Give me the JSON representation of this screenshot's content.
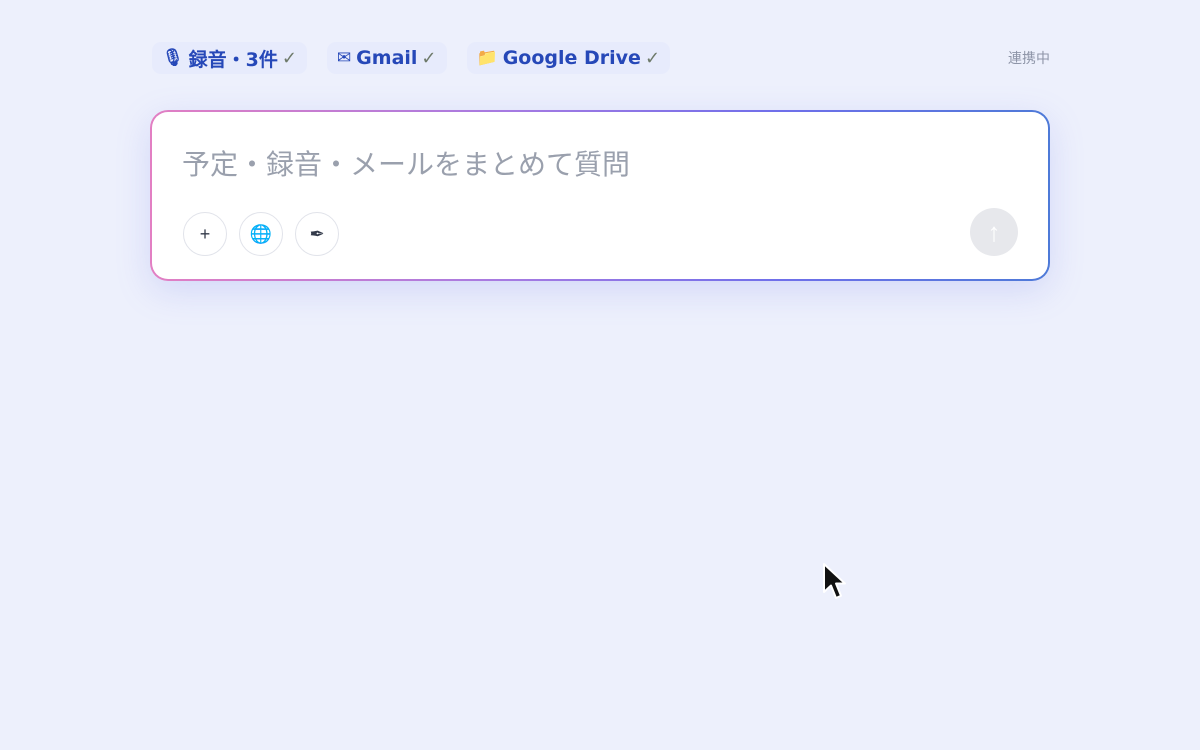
{
  "sources": [
    {
      "icon": "🎙",
      "label": "録音・3件",
      "check": "✓"
    },
    {
      "icon": "✉",
      "label": "Gmail",
      "check": "✓"
    },
    {
      "icon": "📁",
      "label": "Google Drive",
      "check": "✓"
    }
  ],
  "status": "連携中",
  "composer": {
    "placeholder": "予定・録音・メールをまとめて質問",
    "value": "",
    "tools": [
      {
        "icon": "plus-icon",
        "glyph": "+"
      },
      {
        "icon": "globe-icon",
        "glyph": "🌐"
      },
      {
        "icon": "pen-icon",
        "glyph": "✒"
      }
    ],
    "send_glyph": "↑"
  },
  "colors": {
    "background": "#edf0fc",
    "chip_text": "#2648b8",
    "gradient": [
      "#e27fc3",
      "#a57ae2",
      "#6f6fea",
      "#4e7ad8"
    ],
    "send_disabled": "#e7e8ec"
  }
}
